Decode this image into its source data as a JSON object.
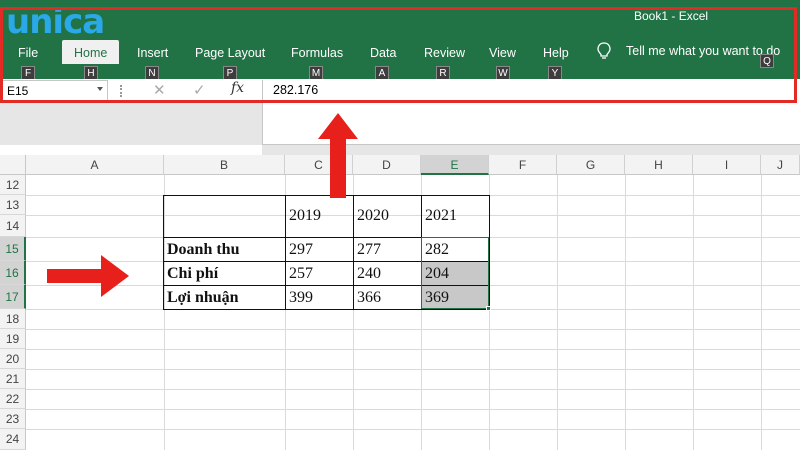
{
  "window": {
    "title": "Book1  -  Excel"
  },
  "logo": {
    "text": "unica"
  },
  "ribbon": {
    "tabs": [
      {
        "label": "File",
        "keytip": "F"
      },
      {
        "label": "Home",
        "keytip": "H"
      },
      {
        "label": "Insert",
        "keytip": "N"
      },
      {
        "label": "Page Layout",
        "keytip": "P"
      },
      {
        "label": "Formulas",
        "keytip": "M"
      },
      {
        "label": "Data",
        "keytip": "A"
      },
      {
        "label": "Review",
        "keytip": "R"
      },
      {
        "label": "View",
        "keytip": "W"
      },
      {
        "label": "Help",
        "keytip": "Y"
      }
    ],
    "active_tab": "Home",
    "tell_me": "Tell me what you want to do",
    "tell_me_keytip": "Q"
  },
  "formula_bar": {
    "name_box": "E15",
    "cancel_glyph": "✕",
    "enter_glyph": "✓",
    "fx_label": "fx",
    "value": "282.176"
  },
  "grid": {
    "columns": [
      "A",
      "B",
      "C",
      "D",
      "E",
      "F",
      "G",
      "H",
      "I",
      "J"
    ],
    "rows": [
      "12",
      "13",
      "14",
      "15",
      "16",
      "17",
      "18",
      "19",
      "20",
      "21",
      "22",
      "23",
      "24"
    ],
    "selected_column": "E",
    "selected_rows": [
      "15",
      "16",
      "17"
    ]
  },
  "table": {
    "years": [
      "2019",
      "2020",
      "2021"
    ],
    "rows": [
      {
        "label": "Doanh thu",
        "values": [
          "297",
          "277",
          "282"
        ]
      },
      {
        "label": "Chi phí",
        "values": [
          "257",
          "240",
          "204"
        ]
      },
      {
        "label": "Lợi nhuận",
        "values": [
          "399",
          "366",
          "369"
        ]
      }
    ]
  },
  "colors": {
    "ribbon": "#217346",
    "highlight": "#e32b26",
    "arrow": "#e8201c",
    "selection": "#217346"
  }
}
